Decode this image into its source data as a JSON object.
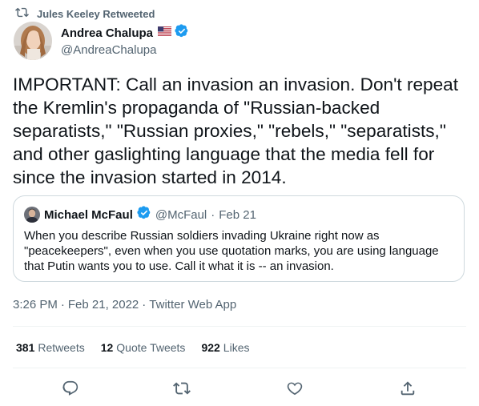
{
  "retweet_context": {
    "text": "Jules Keeley Retweeted"
  },
  "author": {
    "display_name": "Andrea Chalupa",
    "handle": "@AndreaChalupa",
    "flag_icon": "us-flag-icon",
    "verified": true
  },
  "tweet": {
    "text": "IMPORTANT: Call an invasion an invasion. Don't repeat the Kremlin's propaganda of \"Russian-backed separatists,\" \"Russian proxies,\" \"rebels,\" \"separatists,\" and other gaslighting language that the media fell for since the invasion started in 2014."
  },
  "quote": {
    "display_name": "Michael McFaul",
    "handle": "@McFaul",
    "separator": "·",
    "date": "Feb 21",
    "verified": true,
    "text": "When you describe Russian soldiers invading Ukraine right now as \"peacekeepers\", even when you use quotation marks, you are using language that Putin wants you to use. Call it what it is -- an invasion."
  },
  "meta": {
    "time": "3:26 PM",
    "separator": "·",
    "date": "Feb 21, 2022",
    "separator2": "·",
    "app": "Twitter Web App"
  },
  "stats": {
    "retweets_count": "381",
    "retweets_label": "Retweets",
    "quotes_count": "12",
    "quotes_label": "Quote Tweets",
    "likes_count": "922",
    "likes_label": "Likes"
  },
  "actions": [
    "reply-icon",
    "retweet-icon",
    "like-icon",
    "share-icon"
  ],
  "colors": {
    "text": "#0f1419",
    "secondary": "#536471",
    "verified": "#1d9bf0",
    "border": "#cfd9de",
    "divider": "#eff3f4"
  }
}
